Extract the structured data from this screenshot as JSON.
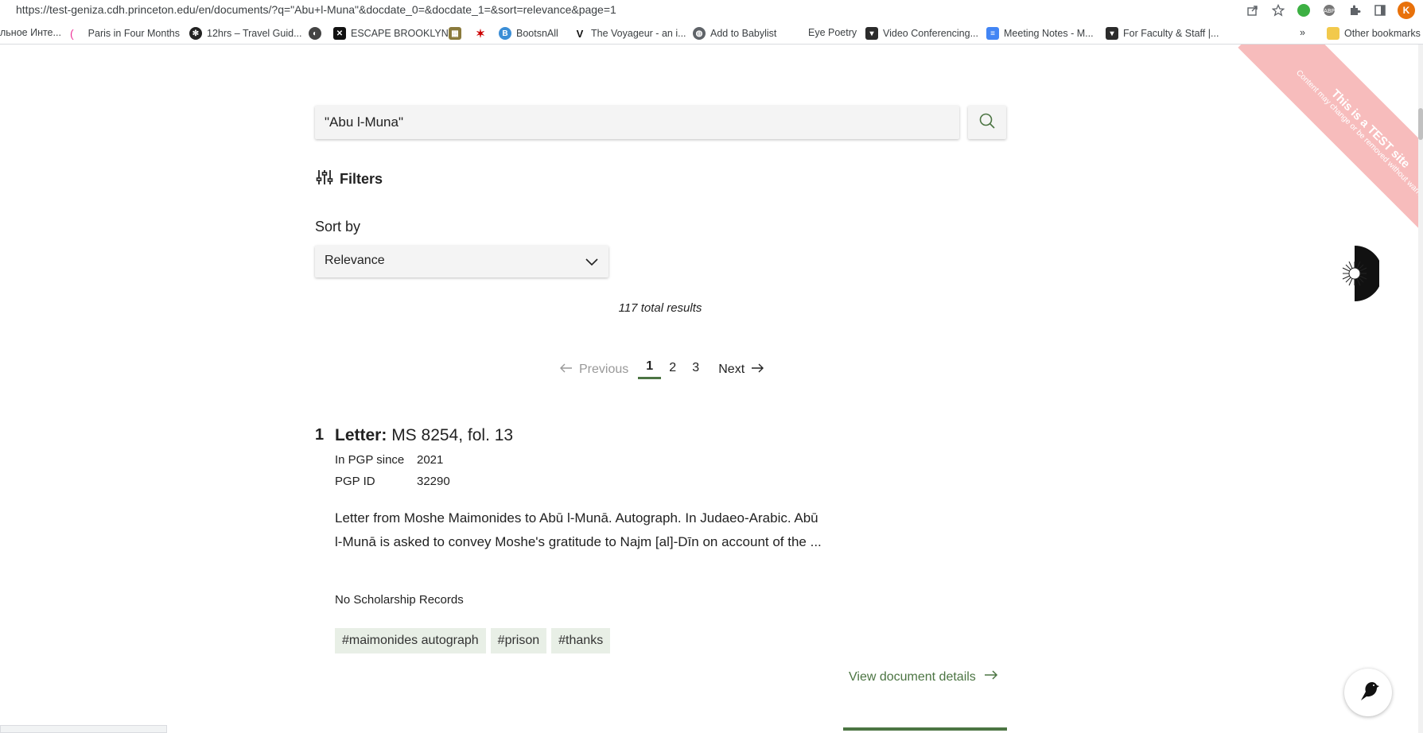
{
  "browser": {
    "url": "https://test-geniza.cdh.princeton.edu/en/documents/?q=\"Abu+l-Muna\"&docdate_0=&docdate_1=&sort=relevance&page=1",
    "profile_initial": "K",
    "overflow": "»",
    "bookmarks": [
      {
        "label": "льное Инте...",
        "icon": "globe-icon"
      },
      {
        "label": "Paris in Four Months",
        "icon": "bookmark-icon"
      },
      {
        "label": "12hrs – Travel Guid...",
        "icon": "bookmark-icon"
      },
      {
        "label": "",
        "icon": "globe-icon"
      },
      {
        "label": "ESCAPE BROOKLYN",
        "icon": "bookmark-icon"
      },
      {
        "label": "",
        "icon": "bookmark-icon"
      },
      {
        "label": "",
        "icon": "bookmark-icon"
      },
      {
        "label": "BootsnAll",
        "icon": "bookmark-icon",
        "glyph": "B"
      },
      {
        "label": "The Voyageur - an i...",
        "icon": "bookmark-icon",
        "glyph": "V"
      },
      {
        "label": "Add to Babylist",
        "icon": "globe-icon"
      },
      {
        "label": "Eye Poetry",
        "icon": "bookmark-icon"
      },
      {
        "label": "Video Conferencing...",
        "icon": "shield-icon"
      },
      {
        "label": "Meeting Notes - M...",
        "icon": "docs-icon"
      },
      {
        "label": "For Faculty & Staff |...",
        "icon": "shield-icon"
      },
      {
        "label": "Other bookmarks",
        "icon": "folder-icon"
      }
    ]
  },
  "ribbon": {
    "line1": "This is a TEST site",
    "line2": "Content may change or be removed without warning"
  },
  "search": {
    "query": "\"Abu l-Muna\""
  },
  "filters": {
    "label": "Filters"
  },
  "sort": {
    "label": "Sort by",
    "selected": "Relevance"
  },
  "results": {
    "total_text": "117 total results"
  },
  "pagination": {
    "previous": "Previous",
    "pages": [
      "1",
      "2",
      "3"
    ],
    "current": "1",
    "next": "Next"
  },
  "result": {
    "number": "1",
    "type": "Letter:",
    "shelfmark": "MS 8254, fol. 13",
    "meta": [
      {
        "label": "In PGP since",
        "value": "2021"
      },
      {
        "label": "PGP ID",
        "value": "32290"
      }
    ],
    "description": "Letter from Moshe Maimonides to Abū l-Munā. Autograph. In Judaeo-Arabic. Abū l-Munā is asked to convey Moshe's gratitude to Najm [al]-Dīn on account of the ...",
    "scholarship": "No Scholarship Records",
    "tags": [
      "#maimonides autograph",
      "#prison",
      "#thanks"
    ],
    "details_link": "View document details"
  },
  "colors": {
    "accent": "#4c7543",
    "tag_bg": "#e8efe6",
    "ribbon": "#f7bcbc"
  }
}
